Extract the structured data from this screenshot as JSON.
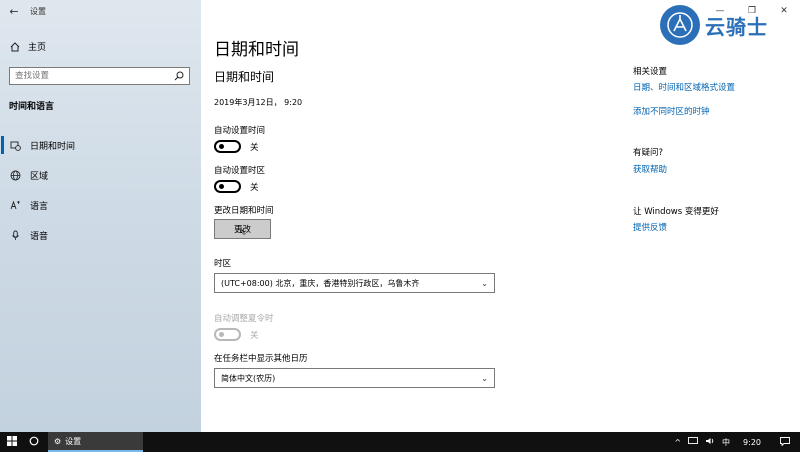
{
  "window": {
    "title": "设置"
  },
  "sidebar": {
    "home_label": "主页",
    "search_placeholder": "查找设置",
    "section_title": "时间和语言",
    "items": [
      {
        "label": "日期和时间",
        "icon": "calendar-clock-icon",
        "active": true
      },
      {
        "label": "区域",
        "icon": "globe-icon",
        "active": false
      },
      {
        "label": "语言",
        "icon": "language-icon",
        "active": false
      },
      {
        "label": "语音",
        "icon": "microphone-icon",
        "active": false
      }
    ]
  },
  "main": {
    "page_title": "日期和时间",
    "sub_title": "日期和时间",
    "current_datetime": "2019年3月12日， 9:20",
    "auto_time": {
      "label": "自动设置时间",
      "state": "关"
    },
    "auto_timezone": {
      "label": "自动设置时区",
      "state": "关"
    },
    "change_dt": {
      "label": "更改日期和时间",
      "button": "更改"
    },
    "timezone": {
      "label": "时区",
      "value": "(UTC+08:00) 北京，重庆，香港特别行政区，乌鲁木齐"
    },
    "dst": {
      "label": "自动调整夏令时",
      "state": "关"
    },
    "calendar": {
      "label": "在任务栏中显示其他日历",
      "value": "简体中文(农历)"
    }
  },
  "related": {
    "title": "相关设置",
    "links": [
      "日期、时间和区域格式设置",
      "添加不同时区的时钟"
    ],
    "question_title": "有疑问?",
    "help_link": "获取帮助",
    "improve_title": "让 Windows 变得更好",
    "feedback_link": "提供反馈"
  },
  "watermark": {
    "text": "云骑士"
  },
  "taskbar": {
    "app_label": "设置",
    "ime": "中",
    "time": "9:20"
  },
  "colors": {
    "accent": "#0063b1"
  }
}
